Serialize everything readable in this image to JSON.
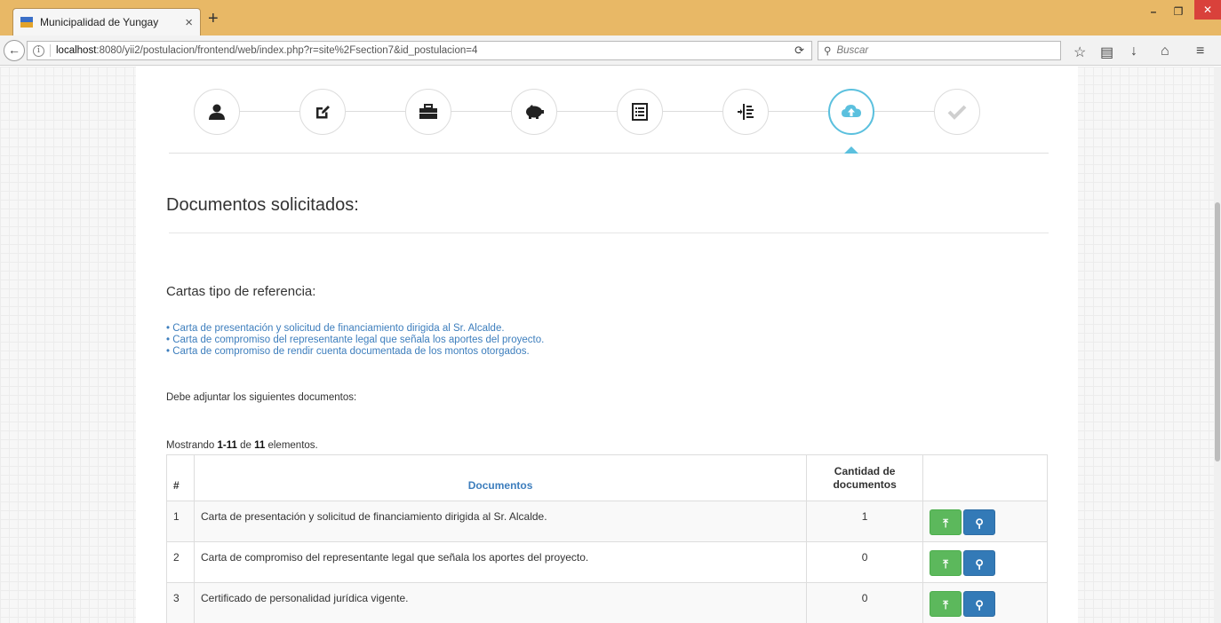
{
  "browser": {
    "tab_title": "Municipalidad de Yungay",
    "tab_close": "×",
    "new_tab": "+",
    "url_host": "localhost",
    "url_rest": ":8080/yii2/postulacion/frontend/web/index.php?r=site%2Fsection7&id_postulacion=4",
    "search_placeholder": "Buscar",
    "window_controls": {
      "minimize": "–",
      "maximize": "❐",
      "close": "✕"
    }
  },
  "wizard": {
    "steps": [
      {
        "icon": "user-icon"
      },
      {
        "icon": "edit-icon"
      },
      {
        "icon": "briefcase-icon"
      },
      {
        "icon": "piggy-bank-icon"
      },
      {
        "icon": "list-alt-icon"
      },
      {
        "icon": "indent-icon"
      },
      {
        "icon": "cloud-upload-icon",
        "active": true
      },
      {
        "icon": "check-icon"
      }
    ],
    "accent_color": "#5bc0de"
  },
  "page": {
    "title": "Documentos solicitados:",
    "references_title": "Cartas tipo de referencia:",
    "reference_links": [
      "• Carta de presentación y solicitud de financiamiento dirigida al Sr. Alcalde.",
      "• Carta de compromiso del representante legal que señala los aportes del proyecto.",
      "• Carta de compromiso de rendir cuenta documentada de los montos otorgados."
    ],
    "attach_note": "Debe adjuntar los siguientes documentos:"
  },
  "grid": {
    "summary_prefix": "Mostrando ",
    "summary_range": "1-11",
    "summary_mid": " de ",
    "summary_total": "11",
    "summary_suffix": " elementos.",
    "headers": {
      "num": "#",
      "documents": "Documentos",
      "count_line1": "Cantidad de",
      "count_line2": "documentos"
    },
    "rows": [
      {
        "num": "1",
        "document": "Carta de presentación y solicitud de financiamiento dirigida al Sr. Alcalde.",
        "count": "1"
      },
      {
        "num": "2",
        "document": "Carta de compromiso del representante legal que señala los aportes del proyecto.",
        "count": "0"
      },
      {
        "num": "3",
        "document": "Certificado de personalidad jurídica vigente.",
        "count": "0"
      }
    ],
    "upload_icon": "upload-icon",
    "view_icon": "search-icon",
    "colors": {
      "upload": "#5cb85c",
      "view": "#337ab7",
      "link": "#3d7ebd"
    }
  }
}
